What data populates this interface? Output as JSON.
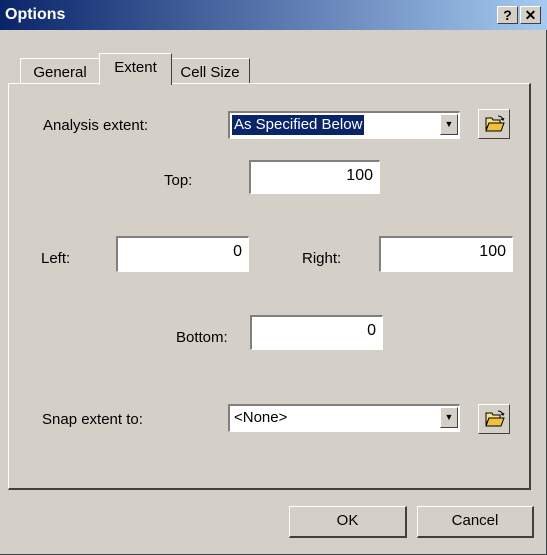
{
  "window": {
    "title": "Options",
    "help_label": "?",
    "close_label": "✕"
  },
  "tabs": [
    {
      "label": "General",
      "active": false
    },
    {
      "label": "Extent",
      "active": true
    },
    {
      "label": "Cell Size",
      "active": false
    }
  ],
  "extent": {
    "analysis_label": "Analysis extent:",
    "analysis_value": "As Specified Below",
    "top_label": "Top:",
    "top_value": "100",
    "left_label": "Left:",
    "left_value": "0",
    "right_label": "Right:",
    "right_value": "100",
    "bottom_label": "Bottom:",
    "bottom_value": "0",
    "snap_label": "Snap extent to:",
    "snap_value": "<None>"
  },
  "buttons": {
    "ok": "OK",
    "cancel": "Cancel"
  },
  "icons": {
    "dropdown": "chevron-down-icon",
    "browse": "open-folder-icon"
  }
}
